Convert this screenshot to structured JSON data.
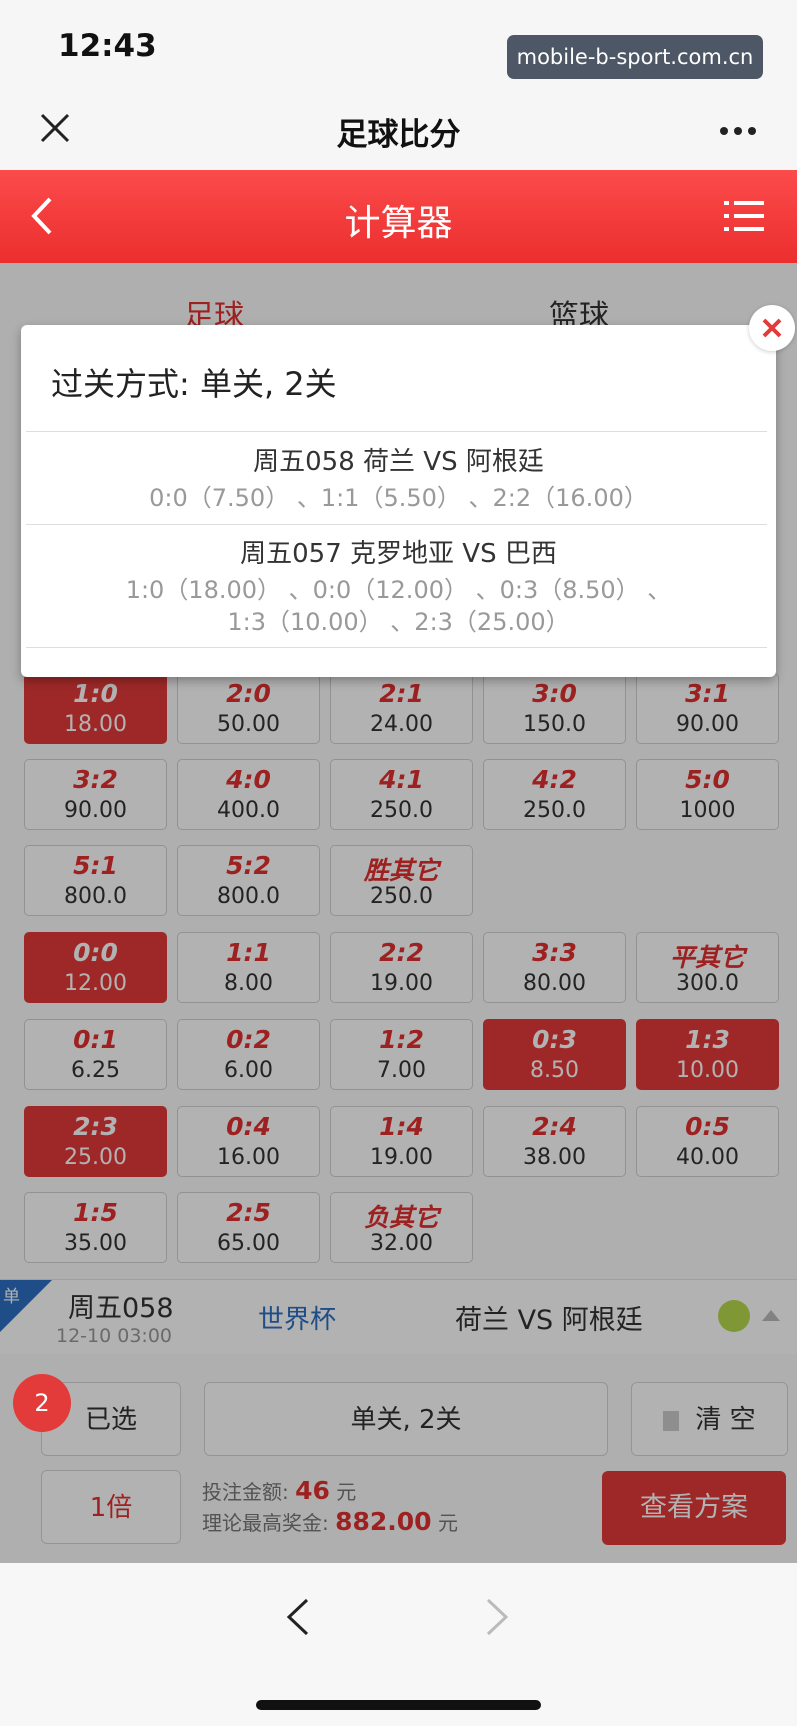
{
  "status": {
    "time": "12:43",
    "url": "mobile-b-sport.com.cn"
  },
  "wechat_nav": {
    "title": "足球比分"
  },
  "header": {
    "title": "计算器"
  },
  "sport_tabs": [
    {
      "label": "足球",
      "active": true
    },
    {
      "label": "篮球",
      "active": false
    }
  ],
  "odds_grid": [
    [
      {
        "score": "1:0",
        "odds": "18.00",
        "selected": true
      },
      {
        "score": "2:0",
        "odds": "50.00",
        "selected": false
      },
      {
        "score": "2:1",
        "odds": "24.00",
        "selected": false
      },
      {
        "score": "3:0",
        "odds": "150.0",
        "selected": false
      },
      {
        "score": "3:1",
        "odds": "90.00",
        "selected": false
      }
    ],
    [
      {
        "score": "3:2",
        "odds": "90.00",
        "selected": false
      },
      {
        "score": "4:0",
        "odds": "400.0",
        "selected": false
      },
      {
        "score": "4:1",
        "odds": "250.0",
        "selected": false
      },
      {
        "score": "4:2",
        "odds": "250.0",
        "selected": false
      },
      {
        "score": "5:0",
        "odds": "1000",
        "selected": false
      }
    ],
    [
      {
        "score": "5:1",
        "odds": "800.0",
        "selected": false
      },
      {
        "score": "5:2",
        "odds": "800.0",
        "selected": false
      },
      {
        "score": "胜其它",
        "odds": "250.0",
        "selected": false
      }
    ],
    [
      {
        "score": "0:0",
        "odds": "12.00",
        "selected": true
      },
      {
        "score": "1:1",
        "odds": "8.00",
        "selected": false
      },
      {
        "score": "2:2",
        "odds": "19.00",
        "selected": false
      },
      {
        "score": "3:3",
        "odds": "80.00",
        "selected": false
      },
      {
        "score": "平其它",
        "odds": "300.0",
        "selected": false
      }
    ],
    [
      {
        "score": "0:1",
        "odds": "6.25",
        "selected": false
      },
      {
        "score": "0:2",
        "odds": "6.00",
        "selected": false
      },
      {
        "score": "1:2",
        "odds": "7.00",
        "selected": false
      },
      {
        "score": "0:3",
        "odds": "8.50",
        "selected": true
      },
      {
        "score": "1:3",
        "odds": "10.00",
        "selected": true
      }
    ],
    [
      {
        "score": "2:3",
        "odds": "25.00",
        "selected": true
      },
      {
        "score": "0:4",
        "odds": "16.00",
        "selected": false
      },
      {
        "score": "1:4",
        "odds": "19.00",
        "selected": false
      },
      {
        "score": "2:4",
        "odds": "38.00",
        "selected": false
      },
      {
        "score": "0:5",
        "odds": "40.00",
        "selected": false
      }
    ],
    [
      {
        "score": "1:5",
        "odds": "35.00",
        "selected": false
      },
      {
        "score": "2:5",
        "odds": "65.00",
        "selected": false
      },
      {
        "score": "负其它",
        "odds": "32.00",
        "selected": false
      }
    ]
  ],
  "match_row": {
    "corner": "单",
    "id": "周五058",
    "time": "12-10 03:00",
    "league": "世界杯",
    "teams": "荷兰 VS 阿根廷"
  },
  "bottom": {
    "badge": "2",
    "selected_label": "已选",
    "pass_label": "单关, 2关",
    "clear_label": "清 空",
    "multiple_label": "1倍",
    "bet_amount_label": "投注金额:",
    "bet_amount_value": "46",
    "bet_amount_unit": "元",
    "max_prize_label": "理论最高奖金:",
    "max_prize_value": "882.00",
    "max_prize_unit": "元",
    "plan_button": "查看方案"
  },
  "modal": {
    "title": "过关方式:  单关, 2关",
    "matches": [
      {
        "title": "周五058 荷兰 VS 阿根廷",
        "picks_line1": "0:0（7.50）  、1:1（5.50）  、2:2（16.00）",
        "picks_line2": ""
      },
      {
        "title": "周五057 克罗地亚 VS 巴西",
        "picks_line1": "1:0（18.00）  、0:0（12.00）  、0:3（8.50）   、",
        "picks_line2": "1:3（10.00）  、2:3（25.00）"
      }
    ]
  },
  "colors": {
    "brand_red": "#e33a3a",
    "league_blue": "#2b6fc2"
  }
}
